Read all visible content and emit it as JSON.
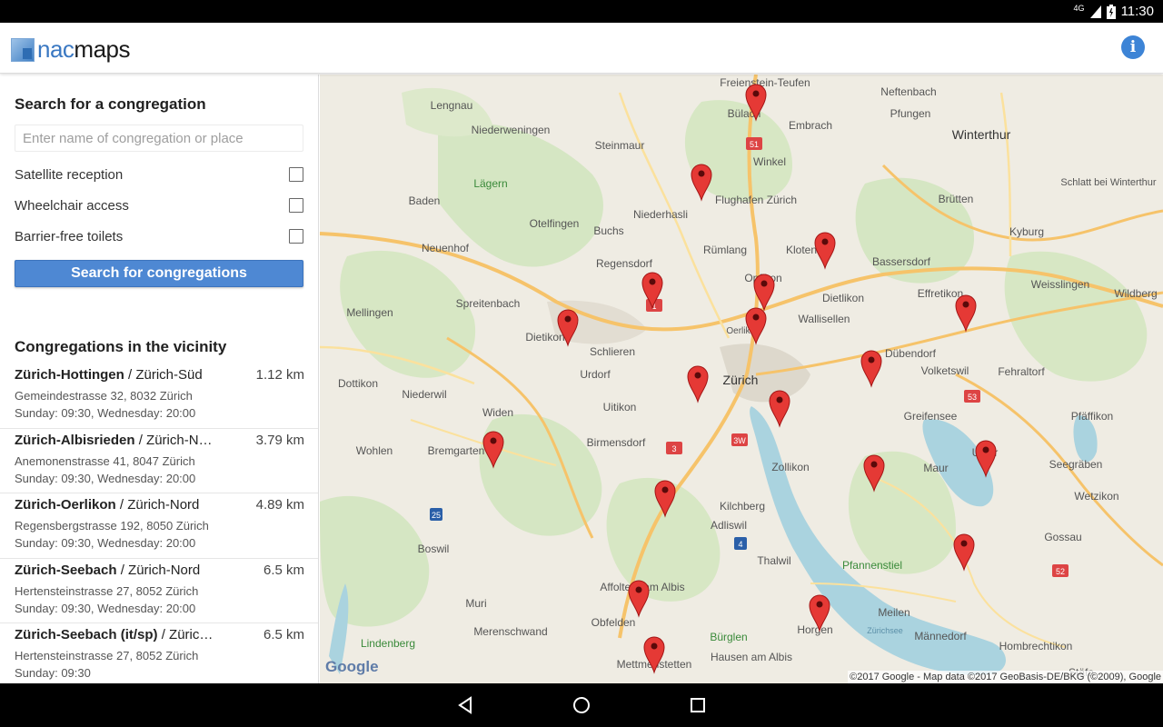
{
  "status_bar": {
    "network": "4G",
    "time": "11:30"
  },
  "app": {
    "logo_prefix": "nac",
    "logo_suffix": "maps"
  },
  "search": {
    "title": "Search for a congregation",
    "placeholder": "Enter name of congregation or place",
    "options": [
      {
        "label": "Satellite reception",
        "checked": false
      },
      {
        "label": "Wheelchair access",
        "checked": false
      },
      {
        "label": "Barrier-free toilets",
        "checked": false
      }
    ],
    "button_label": "Search for congregations"
  },
  "vicinity": {
    "title": "Congregations in the vicinity",
    "items": [
      {
        "name": "Zürich-Hottingen",
        "district": "Zürich-Süd",
        "distance": "1.12 km",
        "address": "Gemeindestrasse 32, 8032 Zürich",
        "schedule": "Sunday: 09:30, Wednesday: 20:00"
      },
      {
        "name": "Zürich-Albisrieden",
        "district": "Zürich-N…",
        "distance": "3.79 km",
        "address": "Anemonenstrasse 41, 8047 Zürich",
        "schedule": "Sunday: 09:30, Wednesday: 20:00"
      },
      {
        "name": "Zürich-Oerlikon",
        "district": "Zürich-Nord",
        "distance": "4.89 km",
        "address": "Regensbergstrasse 192, 8050 Zürich",
        "schedule": "Sunday: 09:30, Wednesday: 20:00"
      },
      {
        "name": "Zürich-Seebach",
        "district": "Zürich-Nord",
        "distance": "6.5 km",
        "address": "Hertensteinstrasse 27, 8052 Zürich",
        "schedule": "Sunday: 09:30, Wednesday: 20:00"
      },
      {
        "name": "Zürich-Seebach (it/sp)",
        "district": "Züric…",
        "distance": "6.5 km",
        "address": "Hertensteinstrasse 27, 8052 Zürich",
        "schedule": "Sunday: 09:30"
      }
    ]
  },
  "map": {
    "places": [
      "Freienstein-Teufen",
      "Neftenbach",
      "Lengnau",
      "Bülach",
      "Pfungen",
      "Embrach",
      "Winterthur",
      "Niederweningen",
      "Steinmaur",
      "Winkel",
      "Schlatt bei Winterthur",
      "Baden",
      "Lägern",
      "Niederhasli",
      "Flughafen Zürich",
      "Brütten",
      "Otelfingen",
      "Buchs",
      "Kyburg",
      "Neuenhof",
      "Rümlang",
      "Kloten",
      "Bassersdorf",
      "Regensdorf",
      "Opfikon",
      "Effretikon",
      "Weisslingen",
      "Spreitenbach",
      "Dietlikon",
      "Wildberg",
      "Mellingen",
      "Wallisellen",
      "Oerlikon",
      "Dietikon",
      "Schlieren",
      "Dübendorf",
      "Urdorf",
      "Volketswil",
      "Fehraltorf",
      "Dottikon",
      "Zürich",
      "Niederwil",
      "Uitikon",
      "Greifensee",
      "Widen",
      "Pfäffikon",
      "Wohlen",
      "Bremgarten",
      "Birmensdorf",
      "Uster",
      "Zollikon",
      "Maur",
      "Seegräben",
      "Wetzikon",
      "Kilchberg",
      "Adliswil",
      "Gossau",
      "Boswil",
      "Thalwil",
      "Pfannenstiel",
      "Affoltern am Albis",
      "Muri",
      "Meilen",
      "Obfelden",
      "Merenschwand",
      "Horgen",
      "Männedorf",
      "Lindenberg",
      "Bürglen",
      "Hombrechtikon",
      "Hausen am Albis",
      "Mettmenstetten",
      "Stäfa",
      "Zürichsee"
    ],
    "road_shields": [
      "51",
      "1",
      "3",
      "3W",
      "4",
      "25",
      "53",
      "52"
    ],
    "google_logo": "Google",
    "attribution": "©2017 Google - Map data ©2017 GeoBasis-DE/BKG (©2009), Google",
    "marker_count": 19,
    "marker_color": "#e53935"
  },
  "colors": {
    "accent": "#4e88d3",
    "info": "#3d84d6"
  }
}
